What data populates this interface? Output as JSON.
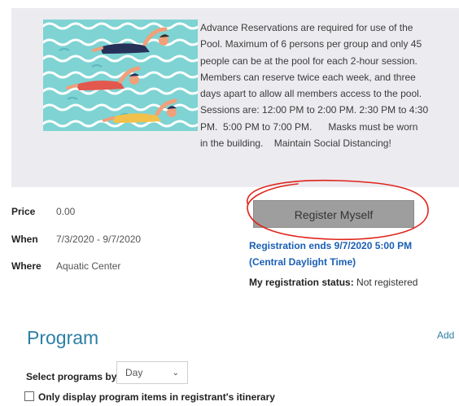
{
  "description_lines": [
    "Advance Reservations are required for use of the",
    "Pool. Maximum of 6 persons per group and only 45",
    "people can be at the pool for each 2-hour session.",
    "Members can reserve twice each week, and three",
    "days apart to allow all members access to the pool.",
    "Sessions are: 12:00 PM to 2:00 PM.  2:30 PM to 4:30",
    "PM.  5:00 PM to 7:00 PM.      Masks must be worn",
    "in the building.    Maintain Social Distancing!"
  ],
  "details": {
    "price_label": "Price",
    "price_value": "0.00",
    "when_label": "When",
    "when_value": "7/3/2020 - 9/7/2020",
    "where_label": "Where",
    "where_value": "Aquatic Center"
  },
  "register": {
    "button_label": "Register Myself",
    "ends_line1": "Registration ends 9/7/2020 5:00 PM",
    "ends_line2": "(Central Daylight Time)",
    "status_label": "My registration status:",
    "status_value": "Not registered"
  },
  "program": {
    "title": "Program",
    "add_label": "Add",
    "select_label": "Select programs by",
    "select_value": "Day",
    "checkbox_label": "Only display program items in registrant's itinerary"
  },
  "colors": {
    "link_blue": "#1a5fb4",
    "heading_blue": "#2d7fa6",
    "button_gray": "#9e9e9e",
    "annotation_red": "#e0241b",
    "panel_bg": "#ecebef",
    "pool_water": "#7fd3d3"
  },
  "icons": {
    "dropdown": "chevron-down-icon",
    "checkbox": "checkbox-icon",
    "illustration": "swimmers-illustration"
  }
}
